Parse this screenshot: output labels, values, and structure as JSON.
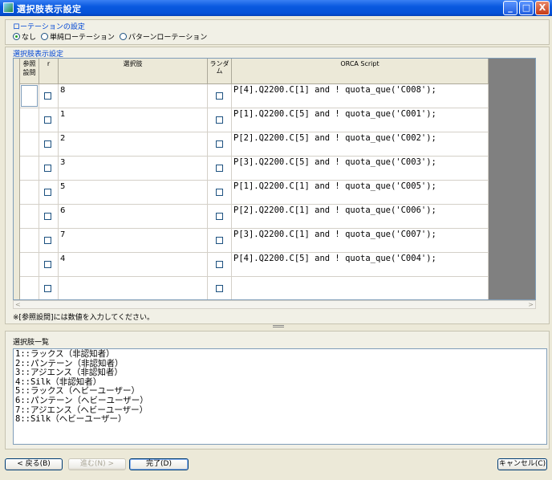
{
  "window": {
    "title": "選択肢表示設定",
    "minimize": "_",
    "maximize": "□",
    "close": "X"
  },
  "rotation": {
    "label": "ローテーションの設定",
    "options": [
      {
        "label": "なし",
        "selected": true
      },
      {
        "label": "単純ローテーション",
        "selected": false
      },
      {
        "label": "パターンローテーション",
        "selected": false
      }
    ]
  },
  "grid": {
    "label": "選択肢表示設定",
    "headers": {
      "ref_line1": "参照",
      "ref_line2": "設問",
      "r": "r",
      "choice": "選択肢",
      "random": "ランダム",
      "script": "ORCA Script"
    },
    "rows": [
      {
        "choice": "8",
        "script": "P[4].Q2200.C[1] and ! quota_que('C008');"
      },
      {
        "choice": "1",
        "script": "P[1].Q2200.C[5] and ! quota_que('C001');"
      },
      {
        "choice": "2",
        "script": "P[2].Q2200.C[5] and ! quota_que('C002');"
      },
      {
        "choice": "3",
        "script": "P[3].Q2200.C[5] and ! quota_que('C003');"
      },
      {
        "choice": "5",
        "script": "P[1].Q2200.C[1] and ! quota_que('C005');"
      },
      {
        "choice": "6",
        "script": "P[2].Q2200.C[1] and ! quota_que('C006');"
      },
      {
        "choice": "7",
        "script": "P[3].Q2200.C[1] and ! quota_que('C007');"
      },
      {
        "choice": "4",
        "script": "P[4].Q2200.C[5] and ! quota_que('C004');"
      },
      {
        "choice": "",
        "script": ""
      }
    ]
  },
  "note": "※[参照設問]には数値を入力してください。",
  "choice_list": {
    "label": "選択肢一覧",
    "items": [
      "1::ラックス（非認知者）",
      "2::パンテーン（非認知者）",
      "3::アジエンス（非認知者）",
      "4::Silk（非認知者）",
      "5::ラックス（ヘビーユーザー）",
      "6::パンテーン（ヘビーユーザー）",
      "7::アジエンス（ヘビーユーザー）",
      "8::Silk（ヘビーユーザー）"
    ]
  },
  "buttons": {
    "back": "< 戻る(B)",
    "next": "進む(N) >",
    "finish": "完了(D)",
    "cancel": "キャンセル(C)"
  }
}
